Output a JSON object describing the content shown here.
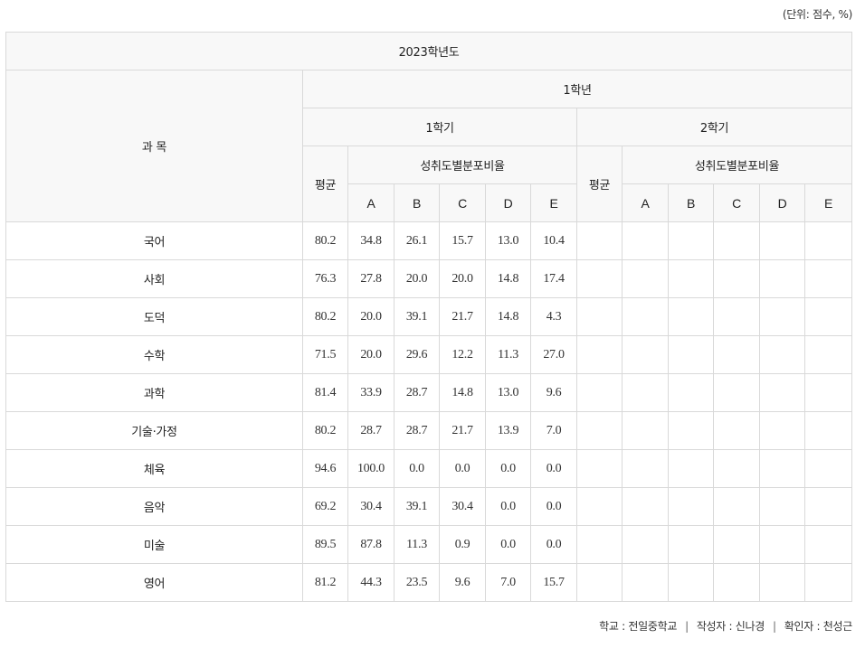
{
  "unit_note": "(단위: 점수, %)",
  "table": {
    "year": "2023학년도",
    "subject_header": "과 목",
    "grade": "1학년",
    "semester1": "1학기",
    "semester2": "2학기",
    "average": "평균",
    "distribution": "성취도별분포비율",
    "letters": [
      "A",
      "B",
      "C",
      "D",
      "E"
    ],
    "rows": [
      {
        "subject": "국어",
        "avg": "80.2",
        "A": "34.8",
        "B": "26.1",
        "C": "15.7",
        "D": "13.0",
        "E": "10.4"
      },
      {
        "subject": "사회",
        "avg": "76.3",
        "A": "27.8",
        "B": "20.0",
        "C": "20.0",
        "D": "14.8",
        "E": "17.4"
      },
      {
        "subject": "도덕",
        "avg": "80.2",
        "A": "20.0",
        "B": "39.1",
        "C": "21.7",
        "D": "14.8",
        "E": "4.3"
      },
      {
        "subject": "수학",
        "avg": "71.5",
        "A": "20.0",
        "B": "29.6",
        "C": "12.2",
        "D": "11.3",
        "E": "27.0"
      },
      {
        "subject": "과학",
        "avg": "81.4",
        "A": "33.9",
        "B": "28.7",
        "C": "14.8",
        "D": "13.0",
        "E": "9.6"
      },
      {
        "subject": "기술·가정",
        "avg": "80.2",
        "A": "28.7",
        "B": "28.7",
        "C": "21.7",
        "D": "13.9",
        "E": "7.0"
      },
      {
        "subject": "체육",
        "avg": "94.6",
        "A": "100.0",
        "B": "0.0",
        "C": "0.0",
        "D": "0.0",
        "E": "0.0"
      },
      {
        "subject": "음악",
        "avg": "69.2",
        "A": "30.4",
        "B": "39.1",
        "C": "30.4",
        "D": "0.0",
        "E": "0.0"
      },
      {
        "subject": "미술",
        "avg": "89.5",
        "A": "87.8",
        "B": "11.3",
        "C": "0.9",
        "D": "0.0",
        "E": "0.0"
      },
      {
        "subject": "영어",
        "avg": "81.2",
        "A": "44.3",
        "B": "23.5",
        "C": "9.6",
        "D": "7.0",
        "E": "15.7"
      }
    ]
  },
  "footer": {
    "school": "학교 : 전일중학교",
    "author": "작성자 : 신나경",
    "confirmer": "확인자 : 천성근",
    "separator": "|"
  }
}
